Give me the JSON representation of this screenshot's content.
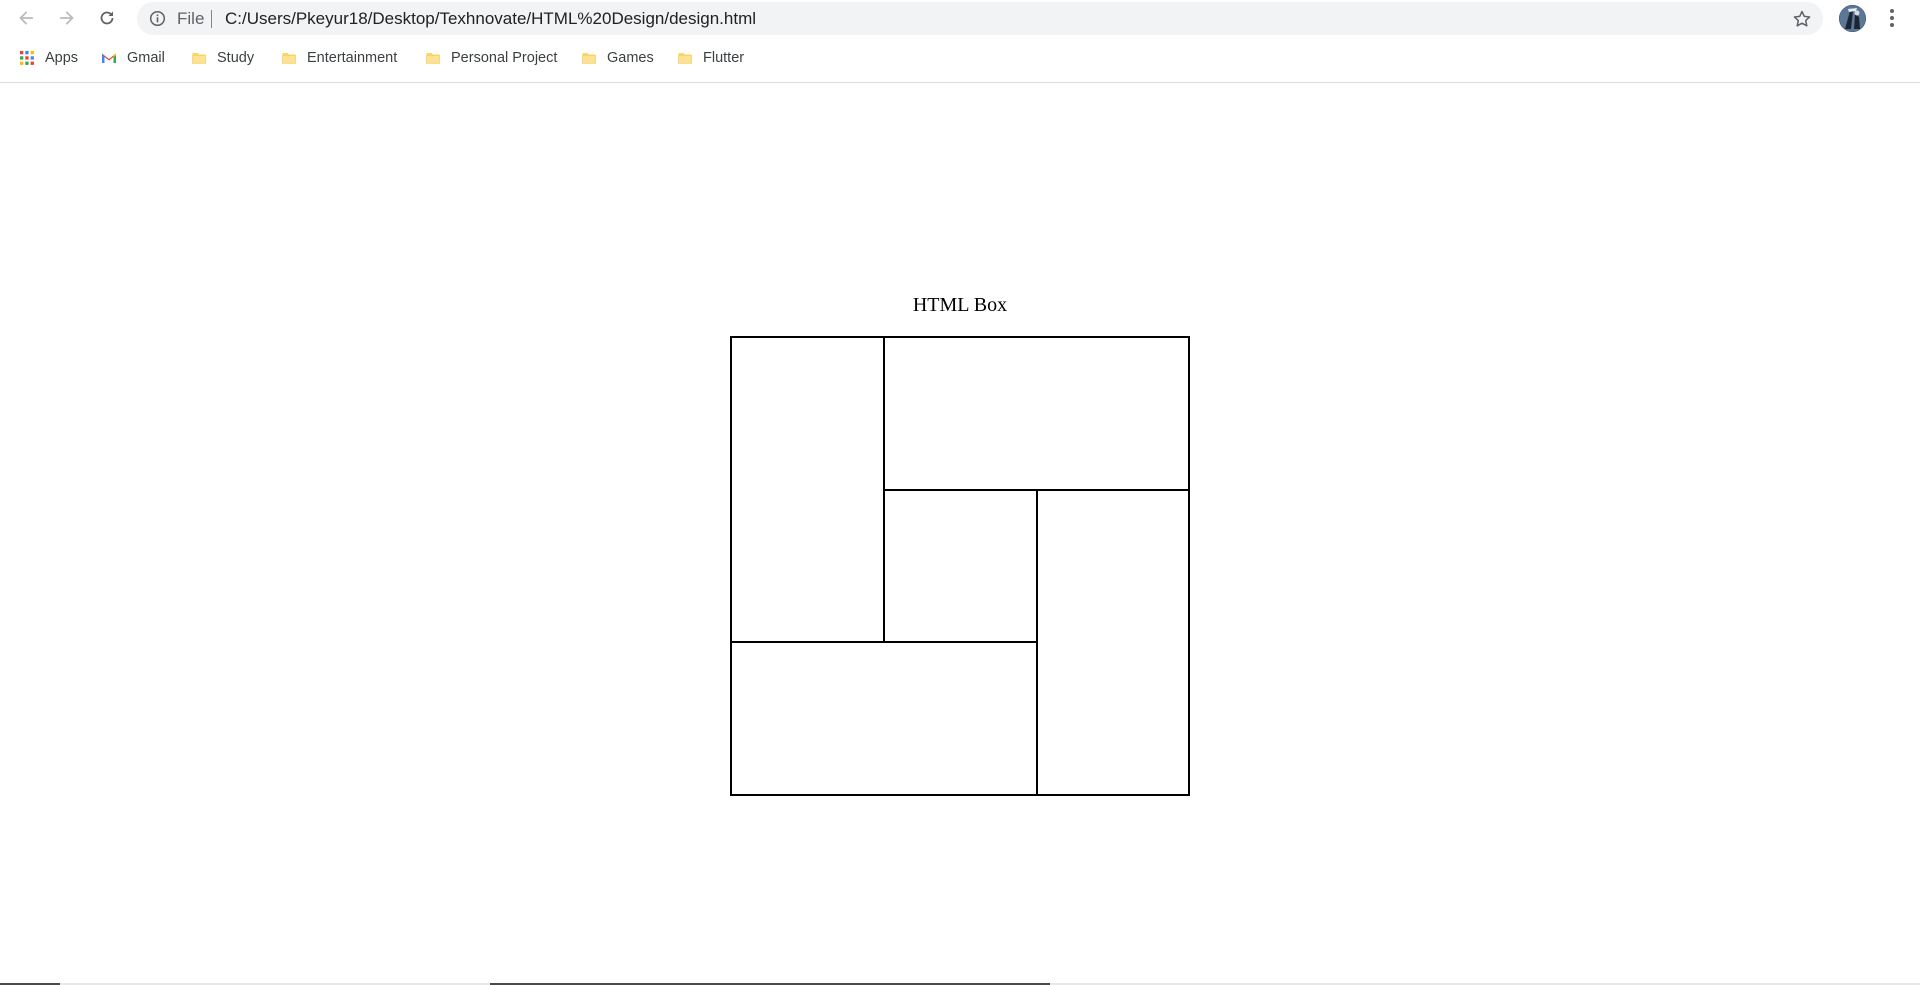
{
  "browser": {
    "nav": {
      "back_icon": "arrow-left-icon",
      "forward_icon": "arrow-right-icon",
      "reload_icon": "reload-icon"
    },
    "omnibox": {
      "scheme_label": "File",
      "url": "C:/Users/Pkeyur18/Desktop/Texhnovate/HTML%20Design/design.html",
      "info_icon": "info-icon",
      "star_icon": "star-icon"
    },
    "profile_icon": "avatar",
    "menu_icon": "more-vert-icon"
  },
  "bookmarks": [
    {
      "label": "Apps",
      "icon": "apps-grid-icon"
    },
    {
      "label": "Gmail",
      "icon": "gmail-icon"
    },
    {
      "label": "Study",
      "icon": "folder-icon"
    },
    {
      "label": "Entertainment",
      "icon": "folder-icon"
    },
    {
      "label": "Personal Project",
      "icon": "folder-icon"
    },
    {
      "label": "Games",
      "icon": "folder-icon"
    },
    {
      "label": "Flutter",
      "icon": "folder-icon"
    }
  ],
  "page": {
    "heading": "HTML Box"
  },
  "colors": {
    "folder": "#fdd663",
    "folder_dark": "#f2c94c",
    "omnibox_bg": "#f1f3f4",
    "border": "#000000"
  }
}
